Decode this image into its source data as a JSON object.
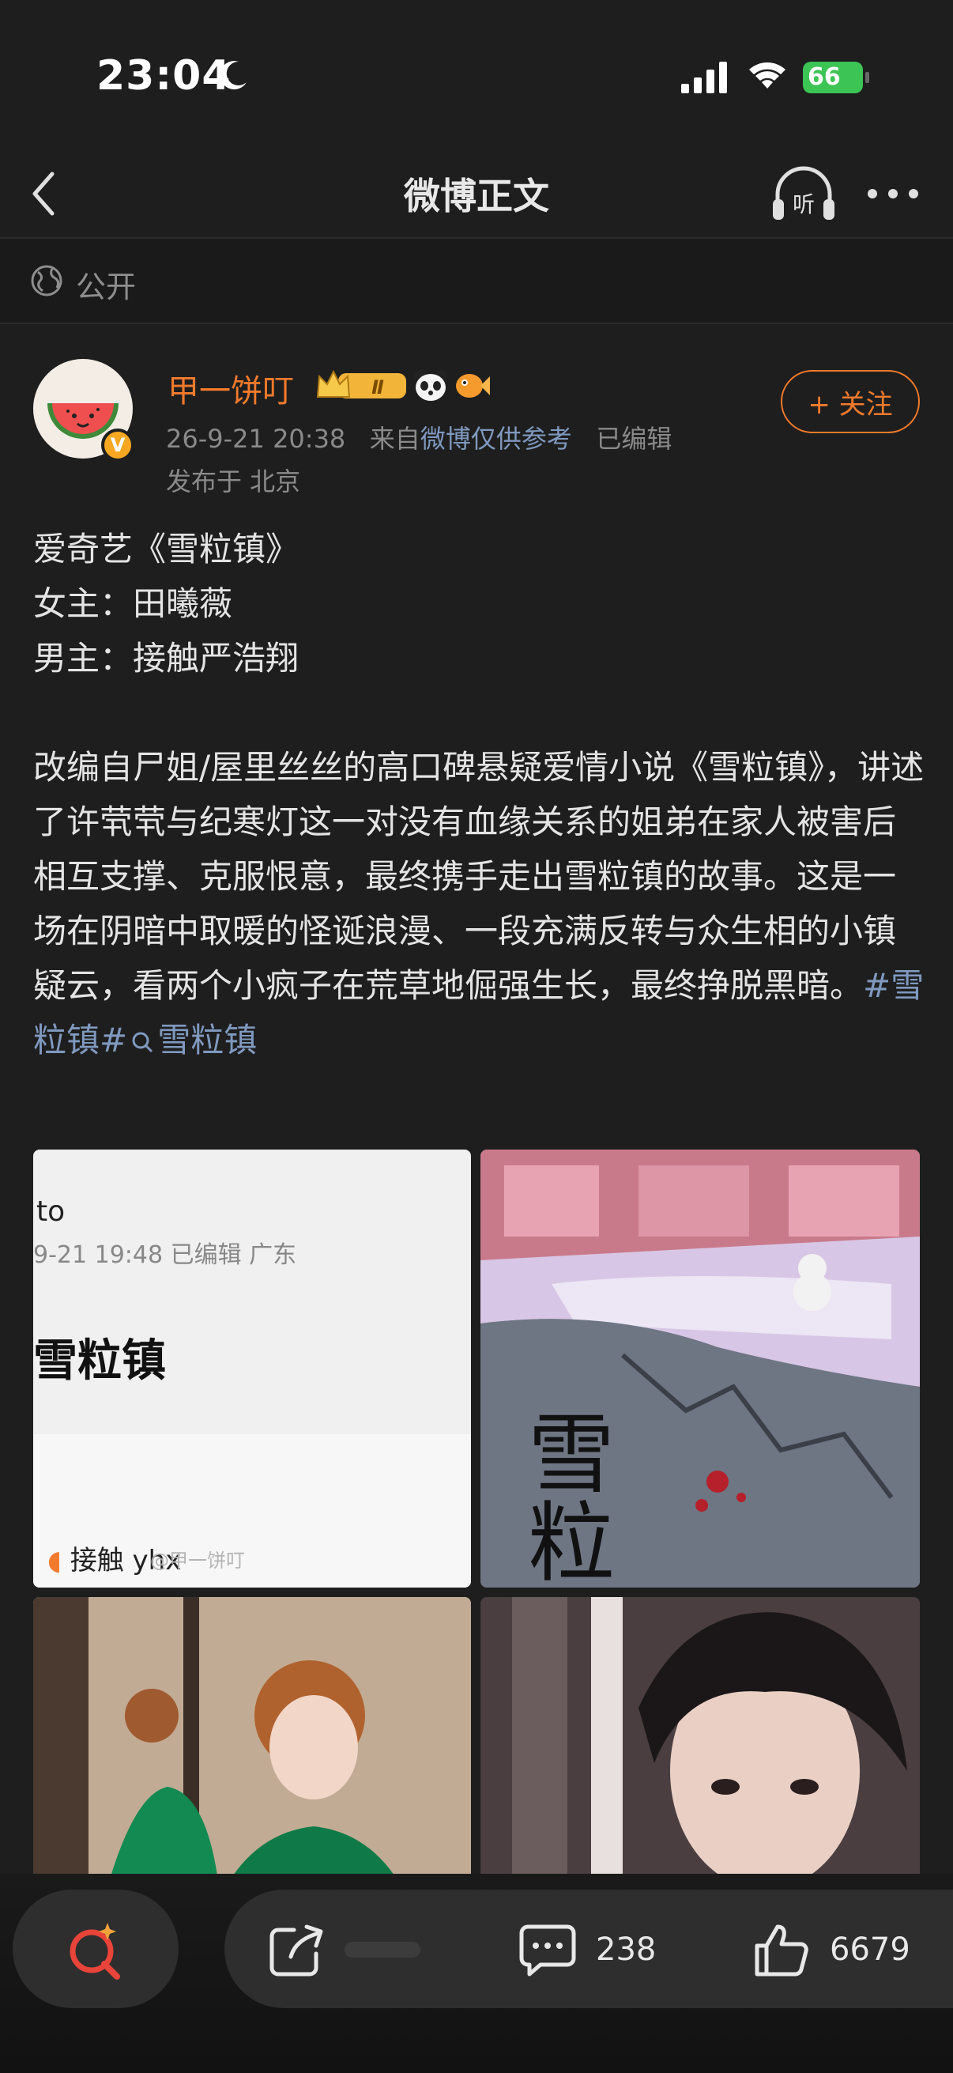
{
  "status_bar": {
    "time": "23:04",
    "battery": "66",
    "icons": [
      "moon-icon",
      "cellular-signal-icon",
      "wifi-icon",
      "battery-charging-icon"
    ]
  },
  "navbar": {
    "title": "微博正文",
    "icons": [
      "back-chevron-icon",
      "listen-headphones-icon",
      "more-dots-icon"
    ]
  },
  "visibility": {
    "label": "公开",
    "icon": "globe-icon"
  },
  "author": {
    "name": "甲一饼叮",
    "verified_badge": "V",
    "level_badge": "Ⅱ",
    "timestamp": "26-9-21 20:38",
    "source_prefix": "来自",
    "source": "微博仅供参考",
    "edited": "已编辑",
    "location": "发布于 北京",
    "follow_label": "+ 关注"
  },
  "post": {
    "lines": [
      "爱奇艺《雪粒镇》",
      "女主：田曦薇",
      "男主：接触严浩翔"
    ],
    "body": "改编自尸姐/屋里丝丝的高口碑悬疑爱情小说《雪粒镇》，讲述了许茕茕与纪寒灯这一对没有血缘关系的姐弟在家人被害后相互支撑、克服恨意，最终携手走出雪粒镇的故事。这是一场在阴暗中取暖的怪诞浪漫、一段充满反转与众生相的小镇疑云，看两个小疯子在荒草地倔强生长，最终挣脱黑暗。",
    "hashtag": "#雪粒镇#",
    "search_link": "雪粒镇"
  },
  "images": {
    "img1": {
      "line1": "to",
      "line2": "9-21 19:48  已编辑  广东",
      "line3": "雪粒镇",
      "line4": "接触 yhx",
      "watermark": "@甲一饼叮"
    },
    "img2": {
      "title": "雪粒镇"
    }
  },
  "toolbar": {
    "comments": "238",
    "likes": "6679"
  },
  "colors": {
    "background": "#1e1e1e",
    "accent_orange": "#f27a2c",
    "link_blue": "#7f99bf",
    "ai_red": "#e8443a"
  }
}
